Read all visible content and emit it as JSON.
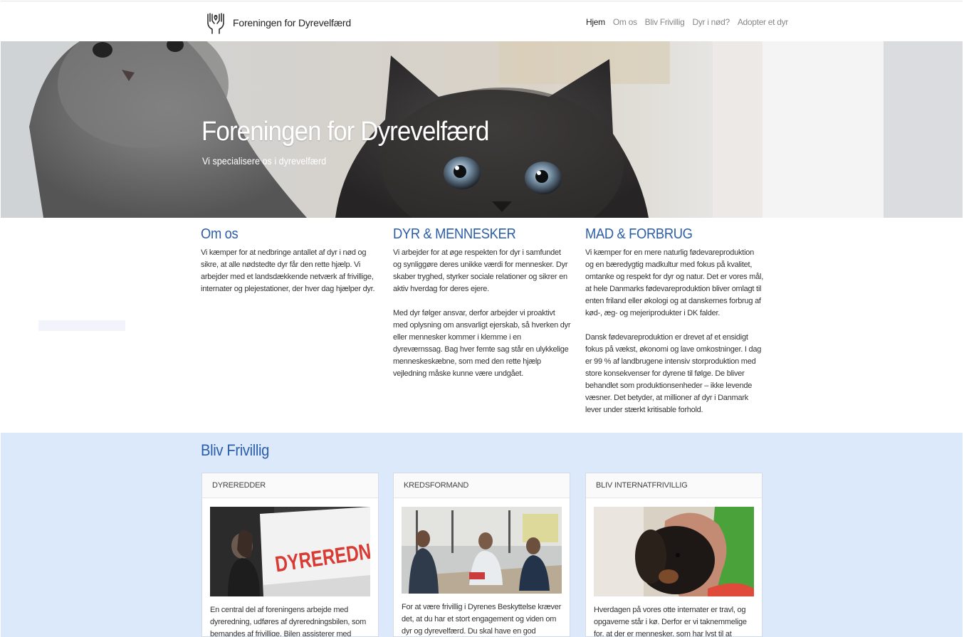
{
  "header": {
    "brand": "Foreningen for Dyrevelfærd",
    "logo_icon": "hands-heart-icon",
    "nav": [
      {
        "label": "Hjem",
        "active": true
      },
      {
        "label": "Om os",
        "active": false
      },
      {
        "label": "Bliv Frivillig",
        "active": false
      },
      {
        "label": "Dyr i nød?",
        "active": false
      },
      {
        "label": "Adopter et dyr",
        "active": false
      }
    ]
  },
  "hero": {
    "title": "Foreningen for Dyrevelfærd",
    "subtitle": "Vi specialisere os i dyrevelfærd"
  },
  "intro": [
    {
      "heading": "Om os",
      "paragraphs": [
        "Vi kæmper for at nedbringe antallet af dyr i nød og sikre, at alle nødstedte dyr får den rette hjælp. Vi arbejder med et landsdækkende netværk af frivillige, internater og plejestationer, der hver dag hjælper dyr."
      ]
    },
    {
      "heading": "DYR & MENNESKER",
      "paragraphs": [
        "Vi arbejder for at øge respekten for dyr i samfundet og synliggøre deres unikke værdi for mennesker. Dyr skaber tryghed, styrker sociale relationer og sikrer en aktiv hverdag for deres ejere.",
        "Med dyr følger ansvar, derfor arbejder vi proaktivt med oplysning om ansvarligt ejerskab, så hverken dyr eller mennesker kommer i klemme i en dyreværnssag. Bag hver femte sag står en ulykkelige menneskeskæbne, som med den rette hjælp vejledning måske kunne være undgået."
      ]
    },
    {
      "heading": "MAD & FORBRUG",
      "paragraphs": [
        "Vi kæmper for en mere naturlig fødevareproduktion og en bæredygtig madkultur med fokus på kvalitet, omtanke og respekt for dyr og natur. Det er vores mål, at hele Danmarks fødevareproduktion bliver omlagt til enten friland eller økologi og at danskernes forbrug af kød-, æg- og mejeriprodukter i DK falder.",
        "Dansk fødevareproduktion er drevet af et ensidigt fokus på vækst, økonomi og lave omkostninger. I dag er 99 % af landbrugene intensiv storproduktion med store konsekvenser for dyrene til følge. De bliver behandlet som produktionsenheder – ikke levende væsner. Det betyder, at millioner af dyr i Danmark lever under stærkt kritisable forhold."
      ]
    }
  ],
  "volunteer": {
    "title": "Bliv Frivillig",
    "cards": [
      {
        "heading": "DYREREDDER",
        "image_text": "DYREREDNING",
        "text": "En central del af foreningens arbejde med dyreredning, udføres af dyreredningsbilen, som bemandes af frivillige. Bilen assisterer med"
      },
      {
        "heading": "KREDSFORMAND",
        "text": "For at være frivillig i Dyrenes Beskyttelse kræver det, at du har et stort engagement og viden om dyr og dyrevelfærd. Du skal have en god vurderingsevne og"
      },
      {
        "heading": "BLIV INTERNATFRIVILLIG",
        "text": "Hverdagen på vores otte internater er travl, og opgaverne står i kø. Derfor er vi taknemmelige for, at der er mennesker, som har lyst til at donere deres tid"
      }
    ]
  }
}
